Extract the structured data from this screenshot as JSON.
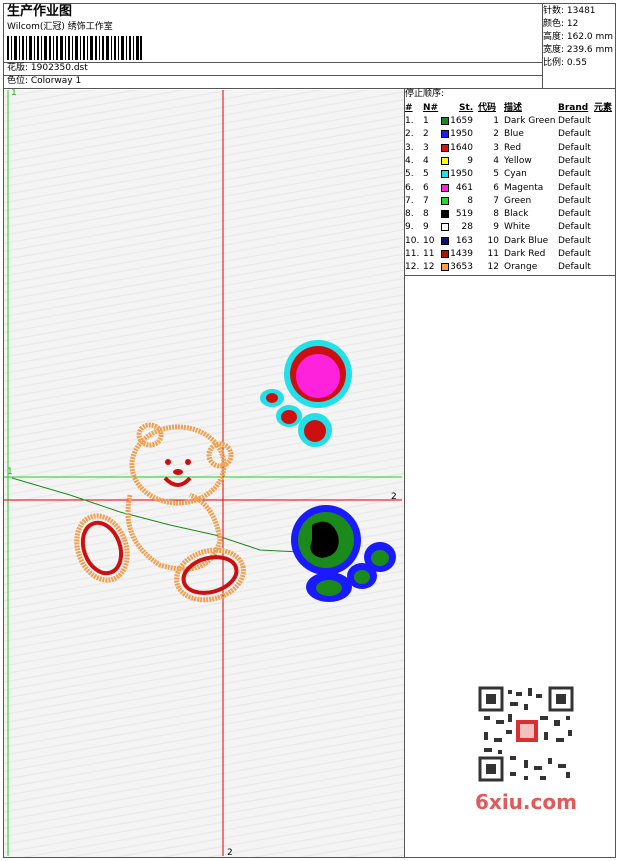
{
  "header": {
    "title": "生产作业图",
    "subtitle": "Wilcom(汇冠) 绣饰工作室",
    "design_label": "花版: 1902350.dst",
    "colorway_label": "色位: Colorway 1"
  },
  "stats": {
    "stitches": "针数: 13481",
    "colors": "颜色: 12",
    "height": "高度: 162.0 mm",
    "width": "宽度: 239.6 mm",
    "scale": "比例: 0.55"
  },
  "stop_sequence": {
    "heading": "停止顺序:",
    "columns": [
      "#",
      "N#",
      "St.",
      "代码",
      "描述",
      "Brand",
      "元素"
    ],
    "rows": [
      {
        "idx": "1.",
        "n": "1",
        "color": "#1a8a1a",
        "st": "1659",
        "code": "1",
        "desc": "Dark Green",
        "brand": "Default"
      },
      {
        "idx": "2.",
        "n": "2",
        "color": "#1a1aff",
        "st": "1950",
        "code": "2",
        "desc": "Blue",
        "brand": "Default"
      },
      {
        "idx": "3.",
        "n": "3",
        "color": "#e01010",
        "st": "1640",
        "code": "3",
        "desc": "Red",
        "brand": "Default"
      },
      {
        "idx": "4.",
        "n": "4",
        "color": "#ffff00",
        "st": "9",
        "code": "4",
        "desc": "Yellow",
        "brand": "Default"
      },
      {
        "idx": "5.",
        "n": "5",
        "color": "#22e0e8",
        "st": "1950",
        "code": "5",
        "desc": "Cyan",
        "brand": "Default"
      },
      {
        "idx": "6.",
        "n": "6",
        "color": "#ff22dd",
        "st": "461",
        "code": "6",
        "desc": "Magenta",
        "brand": "Default"
      },
      {
        "idx": "7.",
        "n": "7",
        "color": "#22dd22",
        "st": "8",
        "code": "7",
        "desc": "Green",
        "brand": "Default"
      },
      {
        "idx": "8.",
        "n": "8",
        "color": "#000000",
        "st": "519",
        "code": "8",
        "desc": "Black",
        "brand": "Default"
      },
      {
        "idx": "9.",
        "n": "9",
        "color": "#ffffff",
        "st": "28",
        "code": "9",
        "desc": "White",
        "brand": "Default"
      },
      {
        "idx": "10.",
        "n": "10",
        "color": "#101070",
        "st": "163",
        "code": "10",
        "desc": "Dark Blue",
        "brand": "Default"
      },
      {
        "idx": "11.",
        "n": "11",
        "color": "#b01010",
        "st": "1439",
        "code": "11",
        "desc": "Dark Red",
        "brand": "Default"
      },
      {
        "idx": "12.",
        "n": "12",
        "color": "#ffa040",
        "st": "3653",
        "code": "12",
        "desc": "Orange",
        "brand": "Default"
      }
    ]
  },
  "canvas_markers": {
    "top_left": "1",
    "left_mid": "1",
    "right_mid": "2",
    "bottom": "2"
  },
  "watermark": "6xiu.com"
}
